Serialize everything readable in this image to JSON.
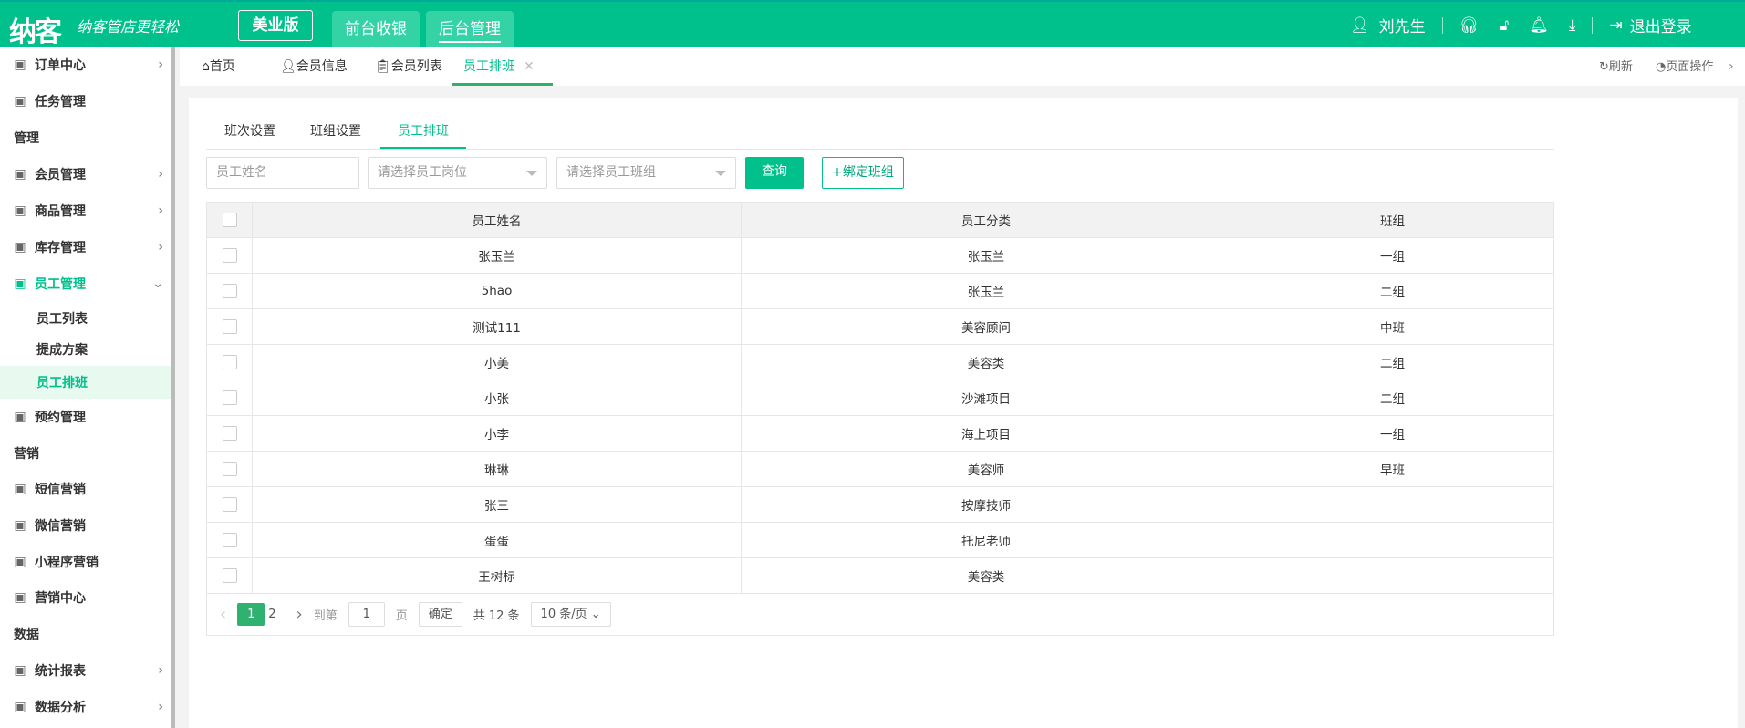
{
  "header": {
    "logo": "纳客",
    "slogan": "纳客管店更轻松",
    "edition": "美业版",
    "tabs": [
      {
        "label": "前台收银"
      },
      {
        "label": "后台管理"
      }
    ],
    "user": "刘先生",
    "logout": "退出登录"
  },
  "sidebar": {
    "items": [
      {
        "label": "订单中心",
        "type": "menu",
        "icon": "globe-icon",
        "chev": "›"
      },
      {
        "label": "任务管理",
        "type": "menu",
        "icon": "task-icon"
      },
      {
        "label": "管理",
        "type": "section"
      },
      {
        "label": "会员管理",
        "type": "menu",
        "icon": "crown-icon",
        "chev": "›"
      },
      {
        "label": "商品管理",
        "type": "menu",
        "icon": "goods-icon",
        "chev": "›"
      },
      {
        "label": "库存管理",
        "type": "menu",
        "icon": "box-icon",
        "chev": "›"
      },
      {
        "label": "员工管理",
        "type": "menu",
        "icon": "user-icon",
        "chev": "⌄",
        "open": true
      },
      {
        "label": "员工列表",
        "type": "sub"
      },
      {
        "label": "提成方案",
        "type": "sub"
      },
      {
        "label": "员工排班",
        "type": "sub",
        "active": true
      },
      {
        "label": "预约管理",
        "type": "menu",
        "icon": "calendar-icon"
      },
      {
        "label": "营销",
        "type": "section"
      },
      {
        "label": "短信营销",
        "type": "menu",
        "icon": "mail-icon"
      },
      {
        "label": "微信营销",
        "type": "menu",
        "icon": "wechat-icon"
      },
      {
        "label": "小程序营销",
        "type": "menu",
        "icon": "miniprogram-icon"
      },
      {
        "label": "营销中心",
        "type": "menu",
        "icon": "target-icon"
      },
      {
        "label": "数据",
        "type": "section"
      },
      {
        "label": "统计报表",
        "type": "menu",
        "icon": "bar-chart-icon",
        "chev": "›"
      },
      {
        "label": "数据分析",
        "type": "menu",
        "icon": "monitor-icon",
        "chev": "›"
      }
    ]
  },
  "tabbar": {
    "tabs": [
      {
        "label": "首页"
      },
      {
        "label": "会员信息"
      },
      {
        "label": "会员列表"
      },
      {
        "label": "员工排班"
      }
    ],
    "refresh": "刷新",
    "page_ops": "页面操作"
  },
  "subtabs": [
    {
      "label": "班次设置"
    },
    {
      "label": "班组设置"
    },
    {
      "label": "员工排班"
    }
  ],
  "filters": {
    "name_placeholder": "员工姓名",
    "position_placeholder": "请选择员工岗位",
    "group_placeholder": "请选择员工班组",
    "query": "查询",
    "bind": "+绑定班组"
  },
  "table": {
    "headers": [
      "员工姓名",
      "员工分类",
      "班组"
    ],
    "rows": [
      [
        "张玉兰",
        "张玉兰",
        "一组"
      ],
      [
        "5hao",
        "张玉兰",
        "二组"
      ],
      [
        "测试111",
        "美容顾问",
        "中班"
      ],
      [
        "小美",
        "美容类",
        "二组"
      ],
      [
        "小张",
        "沙滩项目",
        "二组"
      ],
      [
        "小李",
        "海上项目",
        "一组"
      ],
      [
        "琳琳",
        "美容师",
        "早班"
      ],
      [
        "张三",
        "按摩技师",
        ""
      ],
      [
        "蛋蛋",
        "托尼老师",
        ""
      ],
      [
        "王树标",
        "美容类",
        ""
      ]
    ]
  },
  "pagination": {
    "pages": [
      "1",
      "2"
    ],
    "goto": "到第",
    "page_input": "1",
    "page_unit": "页",
    "confirm": "确定",
    "total": "共 12 条",
    "page_size": "10 条/页"
  }
}
